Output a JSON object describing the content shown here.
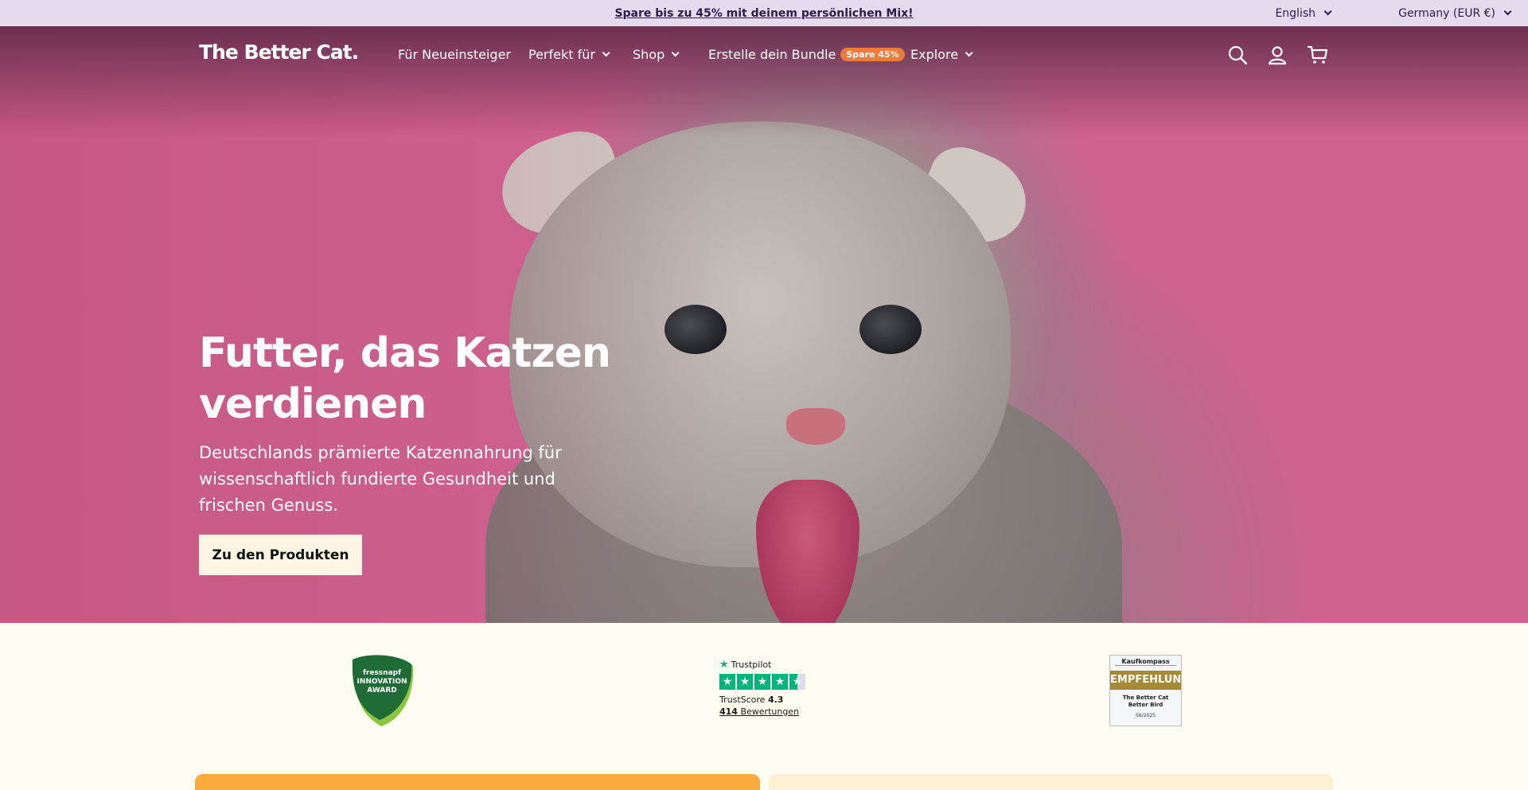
{
  "announcement": {
    "promo_text": "Spare bis zu 45% mit deinem persönlichen Mix!",
    "language": "English",
    "country": "Germany (EUR €)"
  },
  "header": {
    "logo": "The Better Cat.",
    "nav": [
      {
        "label": "Für Neueinsteiger"
      },
      {
        "label": "Perfekt für"
      },
      {
        "label": "Shop"
      },
      {
        "label": "Erstelle dein Bundle",
        "badge": "Spare 45%"
      },
      {
        "label": "Explore"
      }
    ],
    "icons": [
      "search-icon",
      "account-icon",
      "cart-icon"
    ]
  },
  "hero": {
    "title": "Futter, das Katzen verdienen",
    "subtitle": "Deutschlands prämierte Katzennahrung für wissenschaftlich fundierte Gesundheit und frischen Genuss.",
    "cta": "Zu den Produkten",
    "background_color": "#d0628f"
  },
  "awards": {
    "fressnapf": {
      "brand": "fressnapf",
      "line1": "INNOVATION",
      "line2": "AWARD"
    },
    "trustpilot": {
      "brand": "Trustpilot",
      "score_label": "TrustScore",
      "score": "4.3",
      "count": "414",
      "count_label": "Bewertungen"
    },
    "kaufkompass": {
      "brand": "Kaufkompass",
      "label": "EMPFEHLUNG",
      "product_line1": "The Better Cat",
      "product_line2": "Better Bird",
      "date": "06/2025"
    }
  },
  "colors": {
    "announcement_bg": "#e6daee",
    "cta_bg": "#fdf6e4",
    "badge_bg": "#f07a3a",
    "trustpilot_green": "#00b67a",
    "card_orange": "#f9ab3c",
    "card_cream": "#fdf1d3"
  }
}
